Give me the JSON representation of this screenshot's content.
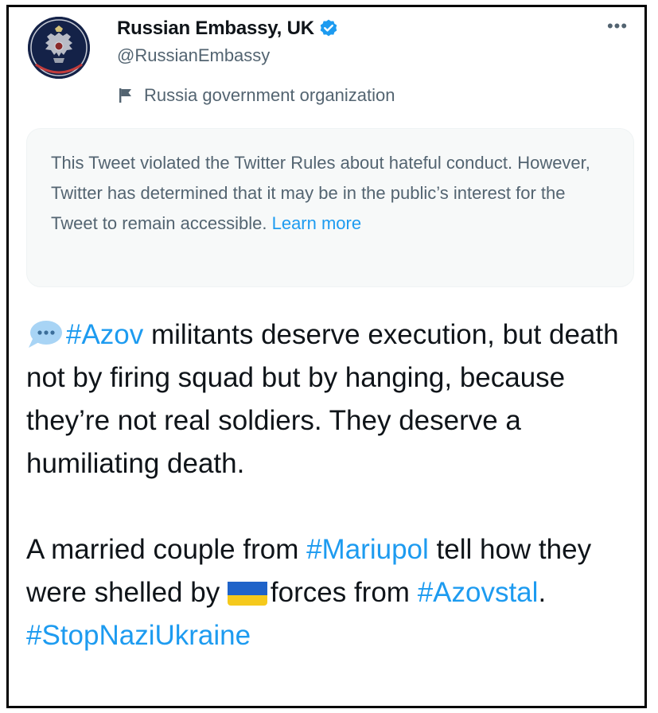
{
  "author": {
    "display_name": "Russian Embassy, UK",
    "handle": "@RussianEmbassy",
    "label": "Russia government organization"
  },
  "more_label": "•••",
  "notice": {
    "text": "This Tweet violated the Twitter Rules about hateful conduct. However, Twitter has determined that it may be in the public’s interest for the Tweet to remain accessible.",
    "link": "Learn more"
  },
  "tweet": {
    "p1": {
      "hashtag": "#Azov",
      "text": " militants deserve execution, but death not by firing squad but by hanging, because they’re not real soldiers. They deserve a humiliating death."
    },
    "p2": {
      "before": "A married couple from ",
      "hashtag1": "#Mariupol",
      "middle": " tell how they were shelled by ",
      "after_flag": "forces from ",
      "hashtag2": "#Azovstal",
      "dot": ". ",
      "hashtag3": "#StopNaziUkraine"
    }
  },
  "colors": {
    "link_blue": "#1d9bf0",
    "secondary_text": "#536471",
    "primary_text": "#0f1419",
    "notice_bg": "#f7f9f9",
    "avatar_bg": "#142248",
    "flag_blue": "#1f63c9",
    "flag_yellow": "#f5c91c"
  },
  "icons": {
    "verified": "verified-badge-icon",
    "label": "flag-icon",
    "speech": "speech-bubble-icon",
    "ukraine_flag": "ukraine-flag-emoji"
  }
}
